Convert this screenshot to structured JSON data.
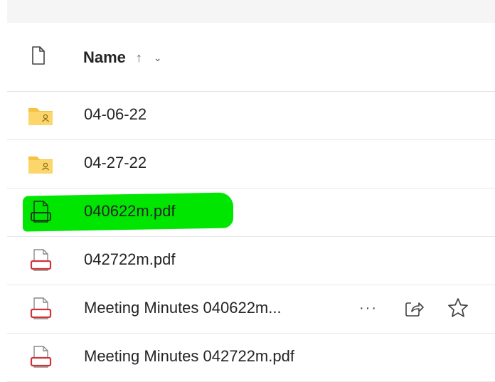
{
  "list": {
    "header": {
      "name_label": "Name",
      "sort_arrow": "↑",
      "sort_menu": "⌄"
    },
    "rows": [
      {
        "name": "04-06-22",
        "type": "shared-folder",
        "highlighted": false
      },
      {
        "name": "04-27-22",
        "type": "shared-folder",
        "highlighted": false
      },
      {
        "name": "040622m.pdf",
        "type": "pdf",
        "highlighted": true,
        "highlight_color": "#00e600"
      },
      {
        "name": "042722m.pdf",
        "type": "pdf",
        "highlighted": false
      },
      {
        "name": "Meeting Minutes 040622m...",
        "type": "pdf",
        "highlighted": false,
        "actions": {
          "more": "···"
        }
      },
      {
        "name": "Meeting Minutes 042722m.pdf",
        "type": "pdf",
        "highlighted": false
      }
    ]
  },
  "colors": {
    "folder": "#f5c242",
    "pdf": "#d13438",
    "highlight": "#00e600"
  }
}
